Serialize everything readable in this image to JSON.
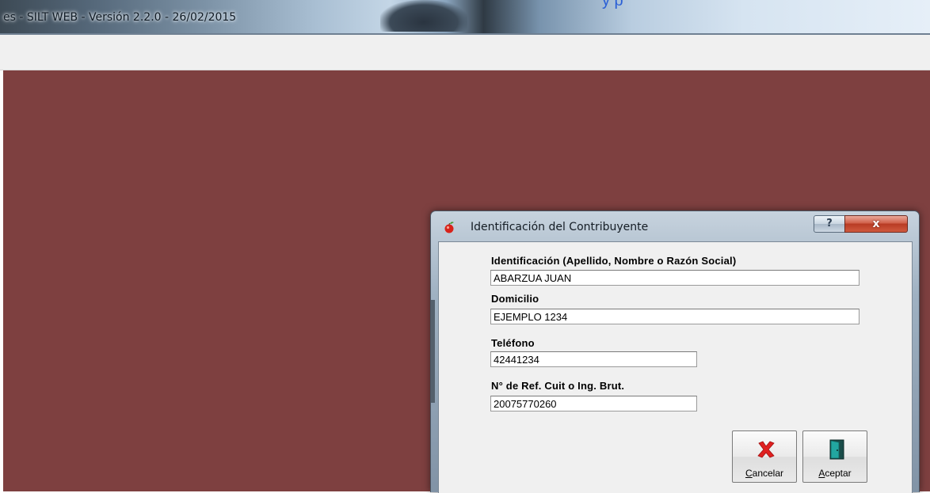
{
  "window": {
    "title": "es - SILT WEB - Versión 2.2.0 - 26/02/2015",
    "overlay_text": "y     p"
  },
  "dialog": {
    "title": "Identificación del Contribuyente",
    "help_label": "?",
    "close_label": "x",
    "fields": {
      "identificacion": {
        "label": "Identificación (Apellido, Nombre o Razón Social)",
        "value": "ABARZUA JUAN"
      },
      "domicilio": {
        "label": "Domicilio",
        "value": "EJEMPLO 1234"
      },
      "telefono": {
        "label": "Teléfono",
        "value": "42441234"
      },
      "ref": {
        "label": "N° de Ref. Cuit o Ing. Brut.",
        "value": "20075770260"
      }
    },
    "buttons": {
      "cancel": {
        "access_key": "C",
        "rest": "ancelar"
      },
      "accept": {
        "access_key": "A",
        "rest": "ceptar"
      }
    }
  },
  "colors": {
    "desktop_background": "#7e4040",
    "dialog_body": "#f0f0f0",
    "cancel_icon": "#e02020",
    "accept_icon": "#1f8f8a"
  },
  "icons": {
    "app_icon": "red-apple-icon",
    "cancel_icon": "red-x-icon",
    "accept_icon": "door-exit-icon"
  }
}
